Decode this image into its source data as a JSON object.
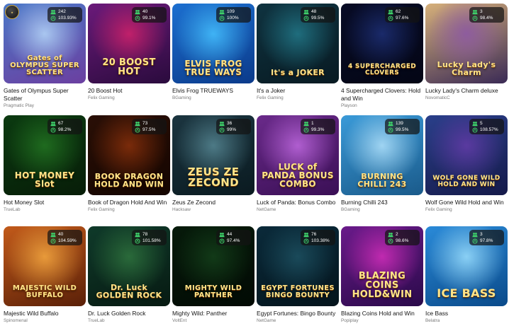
{
  "games": [
    {
      "title": "Gates of Olympus Super Scatter",
      "provider": "Pragmatic Play",
      "players": "242",
      "rtp": "103.93%",
      "logo": "Gates of OLYMPUS SUPER SCATTER",
      "bg": [
        "#4b78c8",
        "#a9c6f0",
        "#6b3fa0"
      ]
    },
    {
      "title": "20 Boost Hot",
      "provider": "Felix Gaming",
      "players": "40",
      "rtp": "99.1%",
      "logo": "20 BOOST HOT",
      "bg": [
        "#6b1a7a",
        "#c0206a",
        "#2a0b3d"
      ]
    },
    {
      "title": "Elvis Frog TRUEWAYS",
      "provider": "BGaming",
      "players": "109",
      "rtp": "100%",
      "logo": "ELVIS FROG TRUE WAYS",
      "bg": [
        "#1c6fd0",
        "#3fb3f5",
        "#0b3a8a"
      ]
    },
    {
      "title": "It's a Joker",
      "provider": "Felix Gaming",
      "players": "48",
      "rtp": "99.5%",
      "logo": "It's a JOKER",
      "bg": [
        "#0f3340",
        "#1f6d7d",
        "#081a22"
      ]
    },
    {
      "title": "4 Supercharged Clovers: Hold and Win",
      "provider": "Playson",
      "players": "62",
      "rtp": "97.6%",
      "logo": "4 SUPERCHARGED CLOVERS",
      "bg": [
        "#070b25",
        "#1a2a6a",
        "#040615"
      ]
    },
    {
      "title": "Lucky Lady's Charm deluxe",
      "provider": "NovomaticC",
      "players": "3",
      "rtp": "98.4%",
      "logo": "Lucky Lady's Charm",
      "bg": [
        "#d6b07a",
        "#8e5c9e",
        "#3a2a55"
      ]
    },
    {
      "title": "Hot Money Slot",
      "provider": "TrueLab",
      "players": "67",
      "rtp": "98.2%",
      "logo": "HOT MONEY Slot",
      "bg": [
        "#0b3a10",
        "#1f6b1f",
        "#071d08"
      ]
    },
    {
      "title": "Book of Dragon Hold And Win",
      "provider": "Felix Gaming",
      "players": "73",
      "rtp": "97.5%",
      "logo": "BOOK DRAGON HOLD AND WIN",
      "bg": [
        "#2a0f06",
        "#7a2b0a",
        "#140500"
      ]
    },
    {
      "title": "Zeus Ze Zecond",
      "provider": "Hacksaw",
      "players": "36",
      "rtp": "99%",
      "logo": "ZEUS ZE ZECOND",
      "bg": [
        "#1b3540",
        "#4d7a86",
        "#0a1a20"
      ]
    },
    {
      "title": "Luck of Panda: Bonus Combo",
      "provider": "NetGame",
      "players": "1",
      "rtp": "99.3%",
      "logo": "LUCK of PANDA BONUS COMBO",
      "bg": [
        "#6a2a8a",
        "#b05ed0",
        "#3a0f55"
      ]
    },
    {
      "title": "Burning Chilli 243",
      "provider": "BGaming",
      "players": "139",
      "rtp": "99.5%",
      "logo": "BURNING CHILLI 243",
      "bg": [
        "#3a9ad8",
        "#9fd4f2",
        "#1a5a8a"
      ]
    },
    {
      "title": "Wolf Gone Wild Hold and Win",
      "provider": "Felix Gaming",
      "players": "5",
      "rtp": "108.57%",
      "logo": "WOLF GONE WILD HOLD AND WIN",
      "bg": [
        "#2a3f8a",
        "#5a3aa0",
        "#151a4a"
      ]
    },
    {
      "title": "Majestic Wild Buffalo",
      "provider": "Spinomenal",
      "players": "40",
      "rtp": "104.59%",
      "logo": "MAJESTIC WILD BUFFALO",
      "bg": [
        "#c25a1a",
        "#e89a3a",
        "#5a2008"
      ]
    },
    {
      "title": "Dr. Luck Golden Rock",
      "provider": "TrueLab",
      "players": "78",
      "rtp": "101.58%",
      "logo": "Dr. Luck GOLDEN ROCK",
      "bg": [
        "#0f3a2a",
        "#2a6a3a",
        "#071a12"
      ]
    },
    {
      "title": "Mighty Wild: Panther",
      "provider": "VoltEnt",
      "players": "44",
      "rtp": "97.4%",
      "logo": "MIGHTY WILD PANTHER",
      "bg": [
        "#061a0a",
        "#123a18",
        "#020a04"
      ]
    },
    {
      "title": "Egypt Fortunes: Bingo Bounty",
      "provider": "NetGame",
      "players": "76",
      "rtp": "103.38%",
      "logo": "EGYPT FORTUNES BINGO BOUNTY",
      "bg": [
        "#0a2a3a",
        "#1a4a5a",
        "#04141c"
      ]
    },
    {
      "title": "Blazing Coins Hold and Win",
      "provider": "Popiplay",
      "players": "2",
      "rtp": "98.6%",
      "logo": "BLAZING COINS HOLD&WIN",
      "bg": [
        "#6a1a8a",
        "#c02ab0",
        "#2a0a4a"
      ]
    },
    {
      "title": "Ice Bass",
      "provider": "Belatra",
      "players": "3",
      "rtp": "97.8%",
      "logo": "ICE BASS",
      "bg": [
        "#2a8ad8",
        "#8ad0f5",
        "#0a4a8a"
      ]
    }
  ],
  "colors": {
    "stat_icon": "#3ecf6a",
    "title": "#151515",
    "provider": "#7a7a7a"
  }
}
